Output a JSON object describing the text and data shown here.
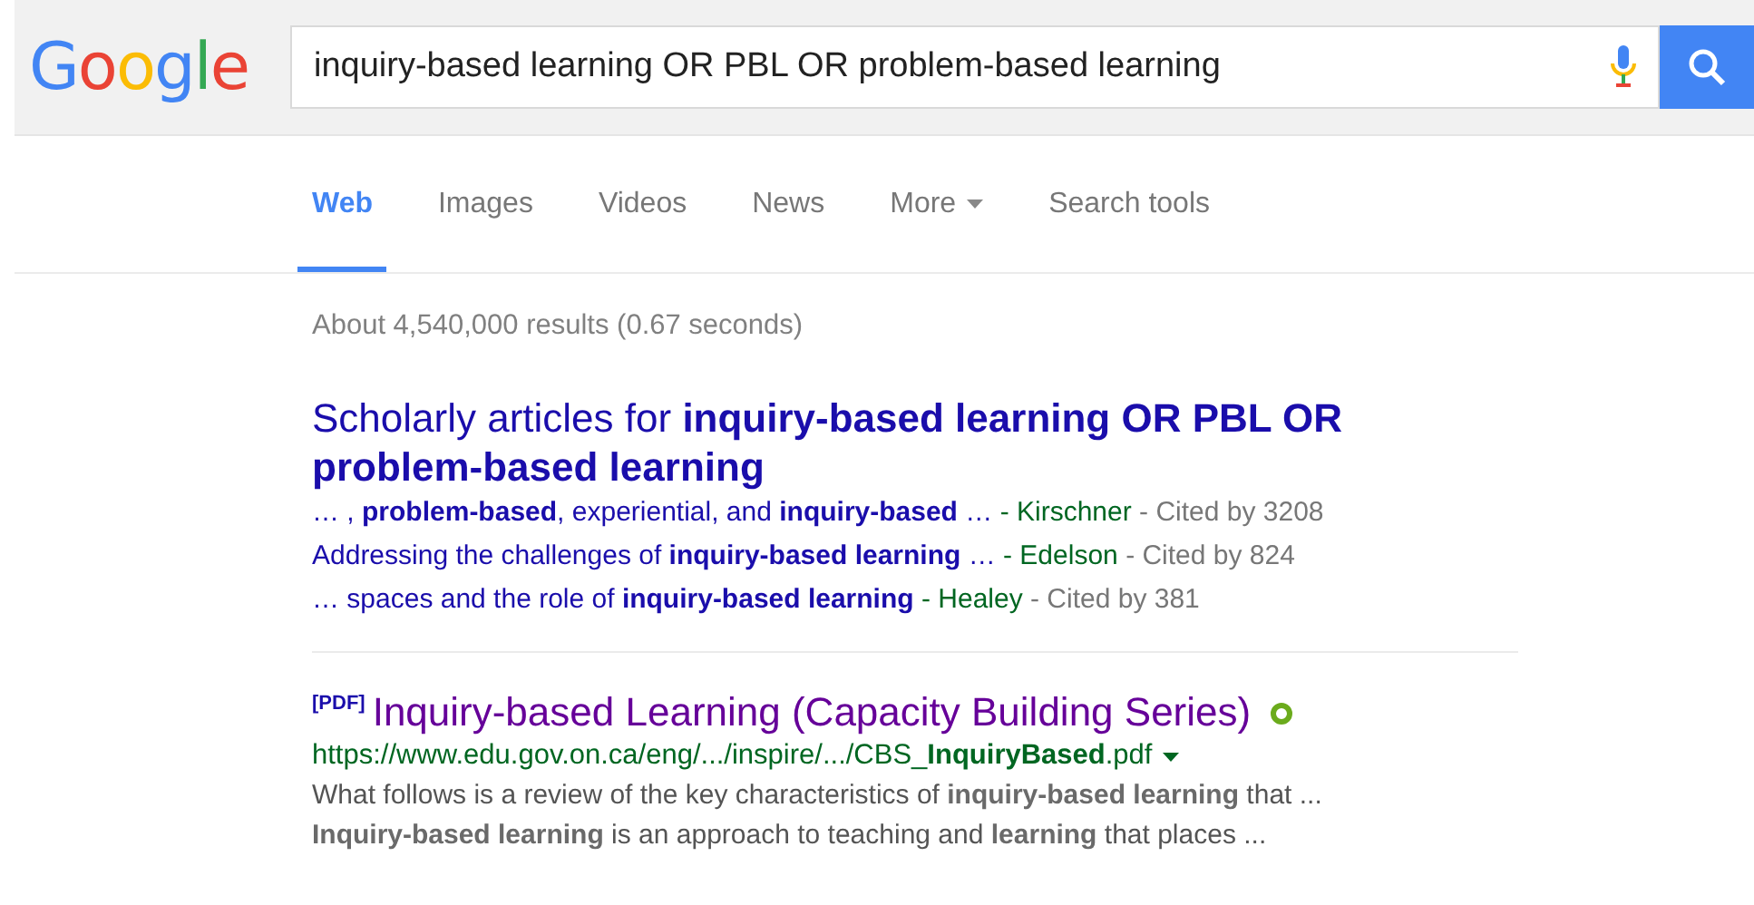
{
  "logo": "Google",
  "search": {
    "value": "inquiry-based learning OR PBL OR problem-based learning"
  },
  "tabs": [
    {
      "label": "Web",
      "selected": true,
      "kind": "tab"
    },
    {
      "label": "Images",
      "selected": false,
      "kind": "tab"
    },
    {
      "label": "Videos",
      "selected": false,
      "kind": "tab"
    },
    {
      "label": "News",
      "selected": false,
      "kind": "tab"
    },
    {
      "label": "More",
      "selected": false,
      "kind": "menu"
    },
    {
      "label": "Search tools",
      "selected": false,
      "kind": "tab"
    }
  ],
  "result_stats": "About 4,540,000 results (0.67 seconds)",
  "scholar": {
    "title": "Scholarly articles for **inquiry-based learning OR PBL OR problem-based learning**",
    "items": [
      {
        "text": "… , **problem-based**, experiential, and **inquiry-based** …",
        "author": "- Kirschner",
        "cited": "- Cited by 3208"
      },
      {
        "text": "Addressing the challenges of **inquiry-based learning** …",
        "author": "- Edelson",
        "cited": "- Cited by 824"
      },
      {
        "text": "… spaces and the role of **inquiry-based learning**",
        "author": "- Healey",
        "cited": "- Cited by 381"
      }
    ]
  },
  "results": [
    {
      "tag": "[PDF]",
      "title": "Inquiry-based Learning (Capacity Building Series)",
      "url": "https://www.edu.gov.on.ca/eng/.../inspire/.../CBS_**InquiryBased**.pdf",
      "snippet": [
        "What follows is a review of the key characteristics of **inquiry-based learning** that ...",
        "**Inquiry-based learning** is an approach to teaching and **learning** that places ..."
      ]
    }
  ]
}
